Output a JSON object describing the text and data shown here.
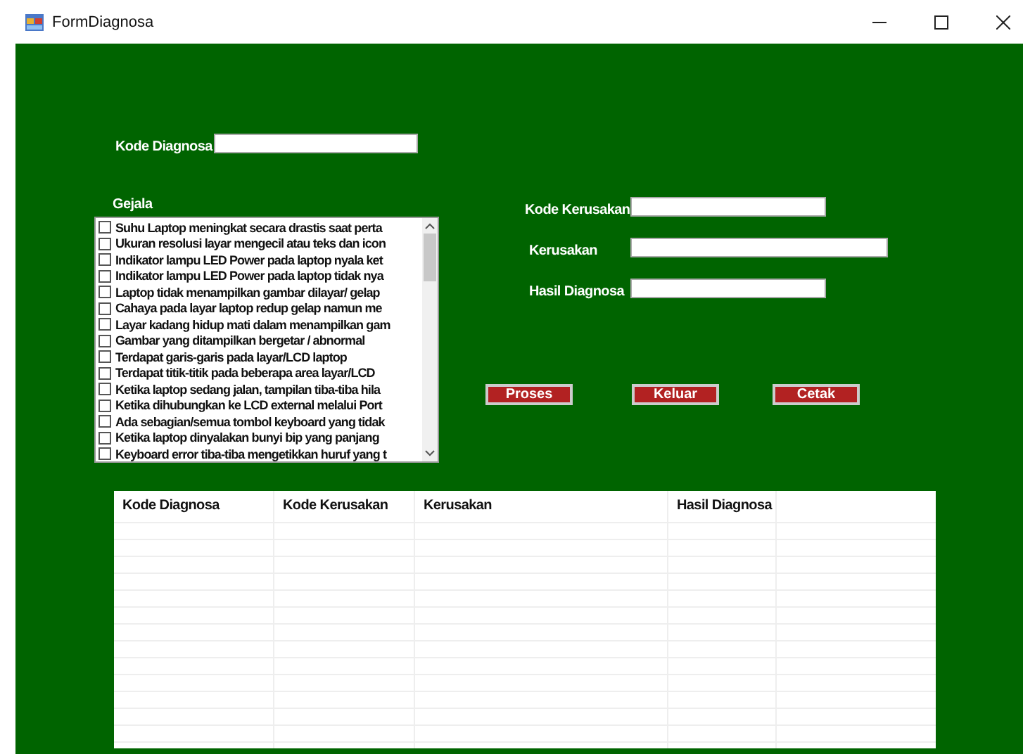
{
  "window": {
    "title": "FormDiagnosa"
  },
  "kode_diagnosa": {
    "label": "Kode Diagnosa"
  },
  "gejala": {
    "label": "Gejala",
    "items": [
      {
        "text": "Suhu Laptop meningkat secara drastis saat perta",
        "checked": false
      },
      {
        "text": "Ukuran resolusi layar mengecil atau teks dan icon",
        "checked": false
      },
      {
        "text": "Indikator lampu LED Power pada laptop nyala ket",
        "checked": false
      },
      {
        "text": "Indikator lampu LED Power pada laptop tidak nya",
        "checked": false
      },
      {
        "text": "Laptop tidak menampilkan gambar dilayar/ gelap",
        "checked": false
      },
      {
        "text": "Cahaya pada layar laptop redup gelap namun me",
        "checked": false
      },
      {
        "text": "Layar kadang hidup mati dalam menampilkan gam",
        "checked": false
      },
      {
        "text": "Gambar yang ditampilkan bergetar / abnormal",
        "checked": false
      },
      {
        "text": "Terdapat garis-garis pada layar/LCD laptop",
        "checked": false
      },
      {
        "text": "Terdapat titik-titik pada beberapa area layar/LCD",
        "checked": false
      },
      {
        "text": "Ketika laptop sedang jalan, tampilan tiba-tiba hila",
        "checked": false
      },
      {
        "text": "Ketika dihubungkan ke LCD external melalui Port",
        "checked": false
      },
      {
        "text": "Ada sebagian/semua tombol keyboard yang tidak",
        "checked": false
      },
      {
        "text": "Ketika laptop dinyalakan bunyi bip yang panjang",
        "checked": false
      },
      {
        "text": "Keyboard error tiba-tiba mengetikkan huruf yang t",
        "checked": false
      }
    ]
  },
  "fields": [
    {
      "label": "Kode Kerusakan"
    },
    {
      "label": "Kerusakan"
    },
    {
      "label": "Hasil Diagnosa"
    }
  ],
  "buttons": [
    "Proses",
    "Keluar",
    "Cetak"
  ],
  "table": {
    "columns": [
      "Kode Diagnosa",
      "Kode Kerusakan",
      "Kerusakan",
      "Hasil Diagnosa"
    ]
  }
}
